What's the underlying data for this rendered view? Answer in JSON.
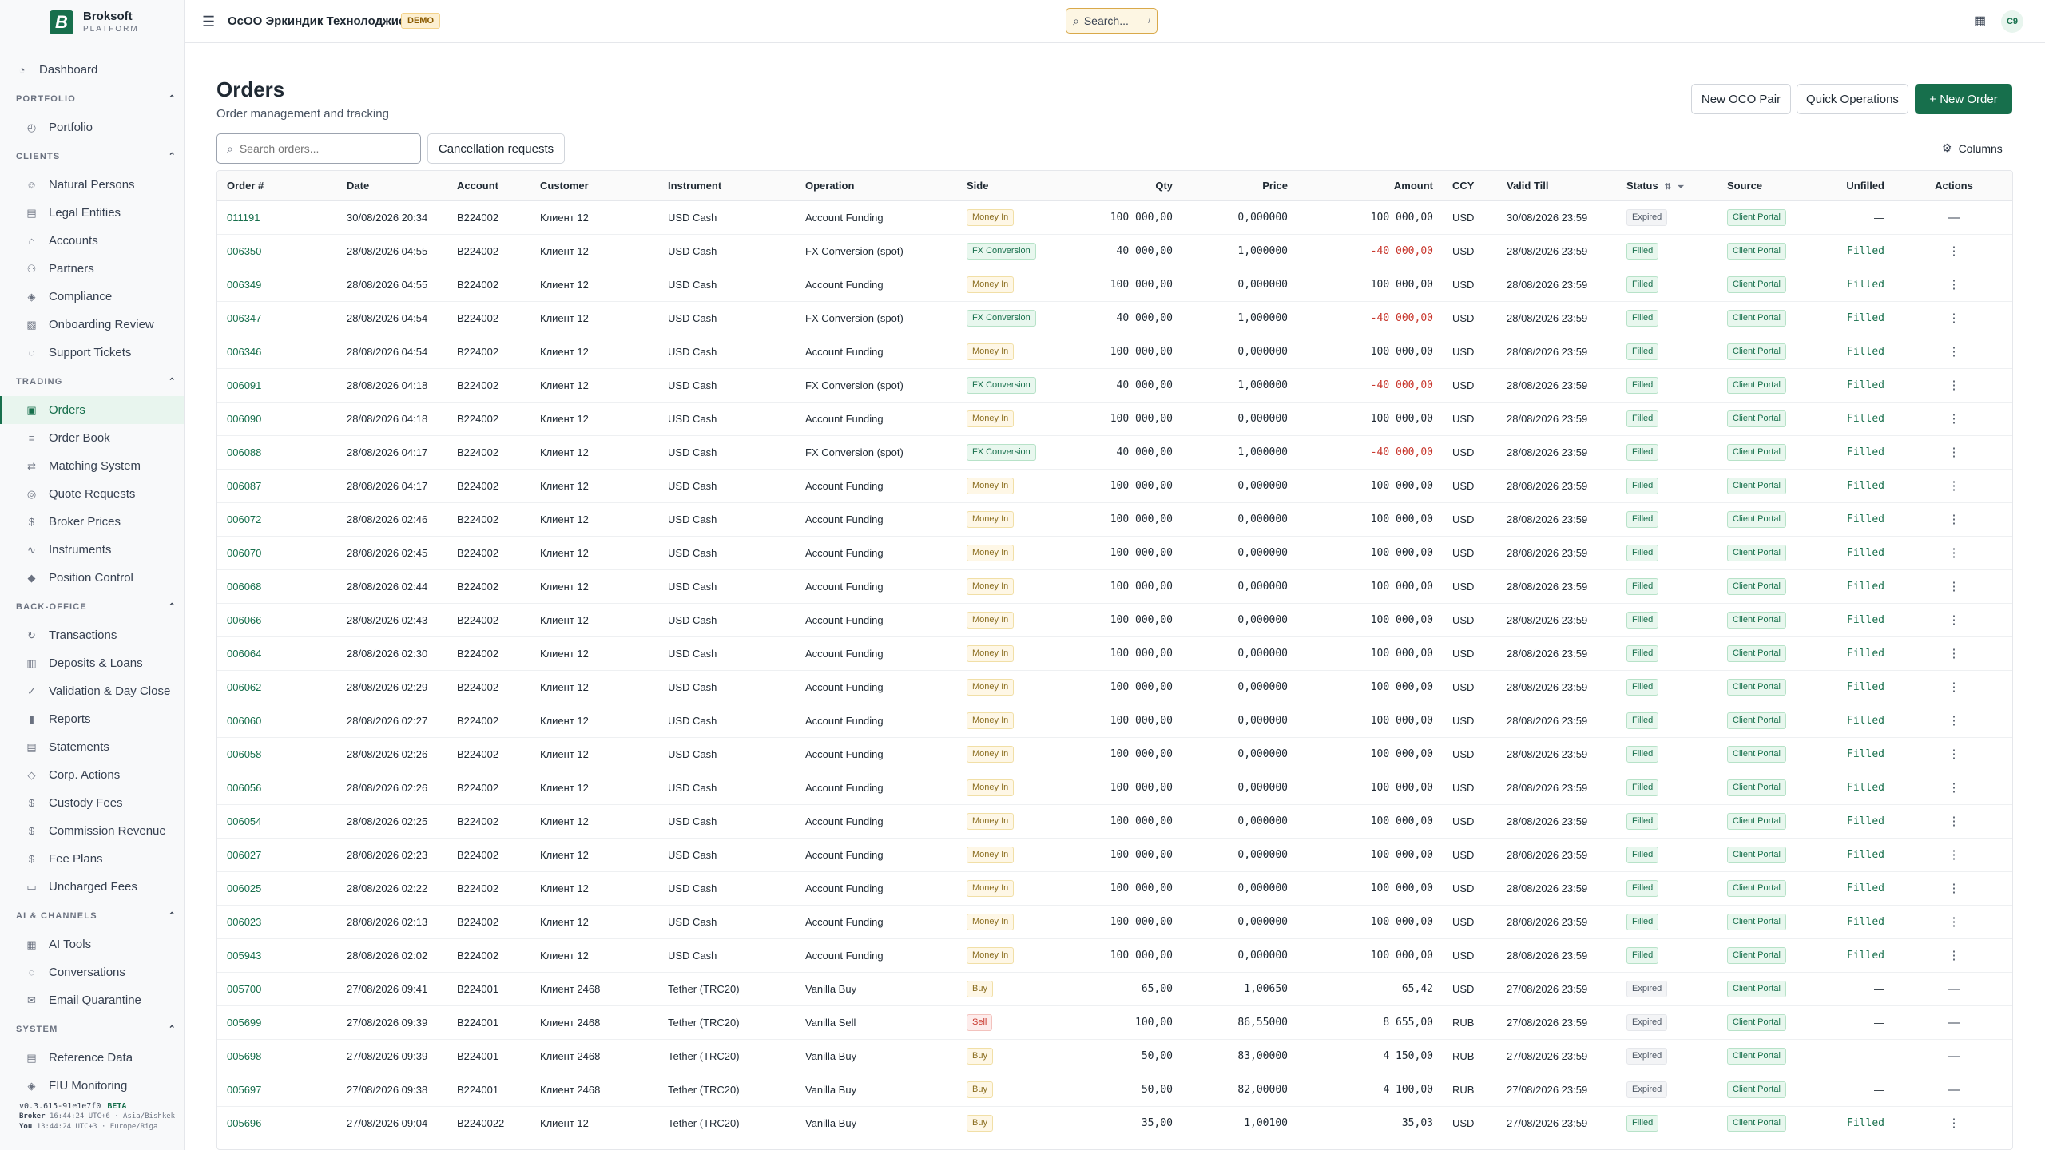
{
  "brand": {
    "name": "Broksoft",
    "sub": "PLATFORM",
    "logo": "B"
  },
  "header": {
    "org": "ОсОО Эркиндик Технолоджис",
    "badge": "DEMO",
    "search_label": "Search...",
    "search_kbd": "/",
    "avatar": "C9"
  },
  "nav": {
    "dashboard": "Dashboard",
    "sections": [
      {
        "title": "PORTFOLIO",
        "items": [
          "Portfolio"
        ]
      },
      {
        "title": "CLIENTS",
        "items": [
          "Natural Persons",
          "Legal Entities",
          "Accounts",
          "Partners",
          "Compliance",
          "Onboarding Review",
          "Support Tickets"
        ]
      },
      {
        "title": "TRADING",
        "items": [
          "Orders",
          "Order Book",
          "Matching System",
          "Quote Requests",
          "Broker Prices",
          "Instruments",
          "Position Control"
        ]
      },
      {
        "title": "BACK-OFFICE",
        "items": [
          "Transactions",
          "Deposits & Loans",
          "Validation & Day Close",
          "Reports",
          "Statements",
          "Corp. Actions",
          "Custody Fees",
          "Commission Revenue",
          "Fee Plans",
          "Uncharged Fees"
        ]
      },
      {
        "title": "AI & CHANNELS",
        "items": [
          "AI Tools",
          "Conversations",
          "Email Quarantine"
        ]
      },
      {
        "title": "SYSTEM",
        "items": [
          "Reference Data",
          "FIU Monitoring"
        ]
      }
    ],
    "active": "Orders"
  },
  "footer": {
    "version": "v0.3.615-91e1e7f0",
    "beta": "BETA",
    "broker_label": "Broker",
    "broker_time": "16:44:24 UTC+6 · Asia/Bishkek",
    "you_label": "You",
    "you_time": "13:44:24 UTC+3 · Europe/Riga"
  },
  "main": {
    "title": "Orders",
    "subtitle": "Order management and tracking",
    "buttons": {
      "oco": "New OCO Pair",
      "quick": "Quick Operations",
      "new": "+ New Order"
    },
    "search_placeholder": "Search orders...",
    "cancel_requests": "Cancellation requests",
    "columns": "Columns"
  },
  "table": {
    "columns": [
      "Order #",
      "Date",
      "Account",
      "Customer",
      "Instrument",
      "Operation",
      "Side",
      "Qty",
      "Price",
      "Amount",
      "CCY",
      "Valid Till",
      "Status",
      "Source",
      "Unfilled",
      "Actions"
    ],
    "rows": [
      [
        "011191",
        "30/08/2026 20:34",
        "B224002",
        "Клиент 12",
        "USD Cash",
        "Account Funding",
        "Money In",
        "100 000,00",
        "0,000000",
        "100 000,00",
        "USD",
        "30/08/2026 23:59",
        "Expired",
        "Client Portal",
        "—",
        "—"
      ],
      [
        "006350",
        "28/08/2026 04:55",
        "B224002",
        "Клиент 12",
        "USD Cash",
        "FX Conversion (spot)",
        "FX Conversion",
        "40 000,00",
        "1,000000",
        "-40 000,00",
        "USD",
        "28/08/2026 23:59",
        "Filled",
        "Client Portal",
        "Filled",
        "⋮"
      ],
      [
        "006349",
        "28/08/2026 04:55",
        "B224002",
        "Клиент 12",
        "USD Cash",
        "Account Funding",
        "Money In",
        "100 000,00",
        "0,000000",
        "100 000,00",
        "USD",
        "28/08/2026 23:59",
        "Filled",
        "Client Portal",
        "Filled",
        "⋮"
      ],
      [
        "006347",
        "28/08/2026 04:54",
        "B224002",
        "Клиент 12",
        "USD Cash",
        "FX Conversion (spot)",
        "FX Conversion",
        "40 000,00",
        "1,000000",
        "-40 000,00",
        "USD",
        "28/08/2026 23:59",
        "Filled",
        "Client Portal",
        "Filled",
        "⋮"
      ],
      [
        "006346",
        "28/08/2026 04:54",
        "B224002",
        "Клиент 12",
        "USD Cash",
        "Account Funding",
        "Money In",
        "100 000,00",
        "0,000000",
        "100 000,00",
        "USD",
        "28/08/2026 23:59",
        "Filled",
        "Client Portal",
        "Filled",
        "⋮"
      ],
      [
        "006091",
        "28/08/2026 04:18",
        "B224002",
        "Клиент 12",
        "USD Cash",
        "FX Conversion (spot)",
        "FX Conversion",
        "40 000,00",
        "1,000000",
        "-40 000,00",
        "USD",
        "28/08/2026 23:59",
        "Filled",
        "Client Portal",
        "Filled",
        "⋮"
      ],
      [
        "006090",
        "28/08/2026 04:18",
        "B224002",
        "Клиент 12",
        "USD Cash",
        "Account Funding",
        "Money In",
        "100 000,00",
        "0,000000",
        "100 000,00",
        "USD",
        "28/08/2026 23:59",
        "Filled",
        "Client Portal",
        "Filled",
        "⋮"
      ],
      [
        "006088",
        "28/08/2026 04:17",
        "B224002",
        "Клиент 12",
        "USD Cash",
        "FX Conversion (spot)",
        "FX Conversion",
        "40 000,00",
        "1,000000",
        "-40 000,00",
        "USD",
        "28/08/2026 23:59",
        "Filled",
        "Client Portal",
        "Filled",
        "⋮"
      ],
      [
        "006087",
        "28/08/2026 04:17",
        "B224002",
        "Клиент 12",
        "USD Cash",
        "Account Funding",
        "Money In",
        "100 000,00",
        "0,000000",
        "100 000,00",
        "USD",
        "28/08/2026 23:59",
        "Filled",
        "Client Portal",
        "Filled",
        "⋮"
      ],
      [
        "006072",
        "28/08/2026 02:46",
        "B224002",
        "Клиент 12",
        "USD Cash",
        "Account Funding",
        "Money In",
        "100 000,00",
        "0,000000",
        "100 000,00",
        "USD",
        "28/08/2026 23:59",
        "Filled",
        "Client Portal",
        "Filled",
        "⋮"
      ],
      [
        "006070",
        "28/08/2026 02:45",
        "B224002",
        "Клиент 12",
        "USD Cash",
        "Account Funding",
        "Money In",
        "100 000,00",
        "0,000000",
        "100 000,00",
        "USD",
        "28/08/2026 23:59",
        "Filled",
        "Client Portal",
        "Filled",
        "⋮"
      ],
      [
        "006068",
        "28/08/2026 02:44",
        "B224002",
        "Клиент 12",
        "USD Cash",
        "Account Funding",
        "Money In",
        "100 000,00",
        "0,000000",
        "100 000,00",
        "USD",
        "28/08/2026 23:59",
        "Filled",
        "Client Portal",
        "Filled",
        "⋮"
      ],
      [
        "006066",
        "28/08/2026 02:43",
        "B224002",
        "Клиент 12",
        "USD Cash",
        "Account Funding",
        "Money In",
        "100 000,00",
        "0,000000",
        "100 000,00",
        "USD",
        "28/08/2026 23:59",
        "Filled",
        "Client Portal",
        "Filled",
        "⋮"
      ],
      [
        "006064",
        "28/08/2026 02:30",
        "B224002",
        "Клиент 12",
        "USD Cash",
        "Account Funding",
        "Money In",
        "100 000,00",
        "0,000000",
        "100 000,00",
        "USD",
        "28/08/2026 23:59",
        "Filled",
        "Client Portal",
        "Filled",
        "⋮"
      ],
      [
        "006062",
        "28/08/2026 02:29",
        "B224002",
        "Клиент 12",
        "USD Cash",
        "Account Funding",
        "Money In",
        "100 000,00",
        "0,000000",
        "100 000,00",
        "USD",
        "28/08/2026 23:59",
        "Filled",
        "Client Portal",
        "Filled",
        "⋮"
      ],
      [
        "006060",
        "28/08/2026 02:27",
        "B224002",
        "Клиент 12",
        "USD Cash",
        "Account Funding",
        "Money In",
        "100 000,00",
        "0,000000",
        "100 000,00",
        "USD",
        "28/08/2026 23:59",
        "Filled",
        "Client Portal",
        "Filled",
        "⋮"
      ],
      [
        "006058",
        "28/08/2026 02:26",
        "B224002",
        "Клиент 12",
        "USD Cash",
        "Account Funding",
        "Money In",
        "100 000,00",
        "0,000000",
        "100 000,00",
        "USD",
        "28/08/2026 23:59",
        "Filled",
        "Client Portal",
        "Filled",
        "⋮"
      ],
      [
        "006056",
        "28/08/2026 02:26",
        "B224002",
        "Клиент 12",
        "USD Cash",
        "Account Funding",
        "Money In",
        "100 000,00",
        "0,000000",
        "100 000,00",
        "USD",
        "28/08/2026 23:59",
        "Filled",
        "Client Portal",
        "Filled",
        "⋮"
      ],
      [
        "006054",
        "28/08/2026 02:25",
        "B224002",
        "Клиент 12",
        "USD Cash",
        "Account Funding",
        "Money In",
        "100 000,00",
        "0,000000",
        "100 000,00",
        "USD",
        "28/08/2026 23:59",
        "Filled",
        "Client Portal",
        "Filled",
        "⋮"
      ],
      [
        "006027",
        "28/08/2026 02:23",
        "B224002",
        "Клиент 12",
        "USD Cash",
        "Account Funding",
        "Money In",
        "100 000,00",
        "0,000000",
        "100 000,00",
        "USD",
        "28/08/2026 23:59",
        "Filled",
        "Client Portal",
        "Filled",
        "⋮"
      ],
      [
        "006025",
        "28/08/2026 02:22",
        "B224002",
        "Клиент 12",
        "USD Cash",
        "Account Funding",
        "Money In",
        "100 000,00",
        "0,000000",
        "100 000,00",
        "USD",
        "28/08/2026 23:59",
        "Filled",
        "Client Portal",
        "Filled",
        "⋮"
      ],
      [
        "006023",
        "28/08/2026 02:13",
        "B224002",
        "Клиент 12",
        "USD Cash",
        "Account Funding",
        "Money In",
        "100 000,00",
        "0,000000",
        "100 000,00",
        "USD",
        "28/08/2026 23:59",
        "Filled",
        "Client Portal",
        "Filled",
        "⋮"
      ],
      [
        "005943",
        "28/08/2026 02:02",
        "B224002",
        "Клиент 12",
        "USD Cash",
        "Account Funding",
        "Money In",
        "100 000,00",
        "0,000000",
        "100 000,00",
        "USD",
        "28/08/2026 23:59",
        "Filled",
        "Client Portal",
        "Filled",
        "⋮"
      ],
      [
        "005700",
        "27/08/2026 09:41",
        "B224001",
        "Клиент 2468",
        "Tether (TRC20)",
        "Vanilla Buy",
        "Buy",
        "65,00",
        "1,00650",
        "65,42",
        "USD",
        "27/08/2026 23:59",
        "Expired",
        "Client Portal",
        "—",
        "—"
      ],
      [
        "005699",
        "27/08/2026 09:39",
        "B224001",
        "Клиент 2468",
        "Tether (TRC20)",
        "Vanilla Sell",
        "Sell",
        "100,00",
        "86,55000",
        "8 655,00",
        "RUB",
        "27/08/2026 23:59",
        "Expired",
        "Client Portal",
        "—",
        "—"
      ],
      [
        "005698",
        "27/08/2026 09:39",
        "B224001",
        "Клиент 2468",
        "Tether (TRC20)",
        "Vanilla Buy",
        "Buy",
        "50,00",
        "83,00000",
        "4 150,00",
        "RUB",
        "27/08/2026 23:59",
        "Expired",
        "Client Portal",
        "—",
        "—"
      ],
      [
        "005697",
        "27/08/2026 09:38",
        "B224001",
        "Клиент 2468",
        "Tether (TRC20)",
        "Vanilla Buy",
        "Buy",
        "50,00",
        "82,00000",
        "4 100,00",
        "RUB",
        "27/08/2026 23:59",
        "Expired",
        "Client Portal",
        "—",
        "—"
      ],
      [
        "005696",
        "27/08/2026 09:04",
        "B2240022",
        "Клиент 12",
        "Tether (TRC20)",
        "Vanilla Buy",
        "Buy",
        "35,00",
        "1,00100",
        "35,03",
        "USD",
        "27/08/2026 23:59",
        "Filled",
        "Client Portal",
        "Filled",
        "⋮"
      ]
    ]
  },
  "colors": {
    "accent": "#176f4c",
    "negative": "#c8372d",
    "warning": "#d9a94a"
  }
}
